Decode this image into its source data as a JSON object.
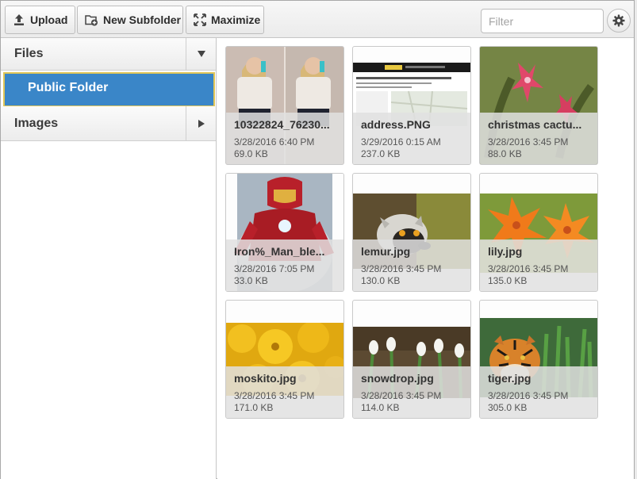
{
  "toolbar": {
    "upload_label": "Upload",
    "new_subfolder_label": "New Subfolder",
    "maximize_label": "Maximize",
    "filter_placeholder": "Filter",
    "settings_icon": "gear-icon"
  },
  "sidebar": {
    "sections": [
      {
        "label": "Files",
        "toggle_icon": "triangle-down-icon",
        "expanded": true
      },
      {
        "label": "Images",
        "toggle_icon": "triangle-right-icon",
        "expanded": false
      }
    ],
    "selected_folder": "Public Folder"
  },
  "files": [
    {
      "name": "10322824_76230...",
      "date": "3/28/2016 6:40 PM",
      "size": "69.0 KB"
    },
    {
      "name": "address.PNG",
      "date": "3/29/2016 0:15 AM",
      "size": "237.0 KB"
    },
    {
      "name": "christmas cactu...",
      "date": "3/28/2016 3:45 PM",
      "size": "88.0 KB"
    },
    {
      "name": "Iron%_Man_ble...",
      "date": "3/28/2016 7:05 PM",
      "size": "33.0 KB"
    },
    {
      "name": "lemur.jpg",
      "date": "3/28/2016 3:45 PM",
      "size": "130.0 KB"
    },
    {
      "name": "lily.jpg",
      "date": "3/28/2016 3:45 PM",
      "size": "135.0 KB"
    },
    {
      "name": "moskito.jpg",
      "date": "3/28/2016 3:45 PM",
      "size": "171.0 KB"
    },
    {
      "name": "snowdrop.jpg",
      "date": "3/28/2016 3:45 PM",
      "size": "114.0 KB"
    },
    {
      "name": "tiger.jpg",
      "date": "3/28/2016 3:45 PM",
      "size": "305.0 KB"
    }
  ],
  "colors": {
    "selected_bg": "#3a86c8",
    "selected_border": "#e1c657",
    "toolbar_bg": "#efefef"
  }
}
